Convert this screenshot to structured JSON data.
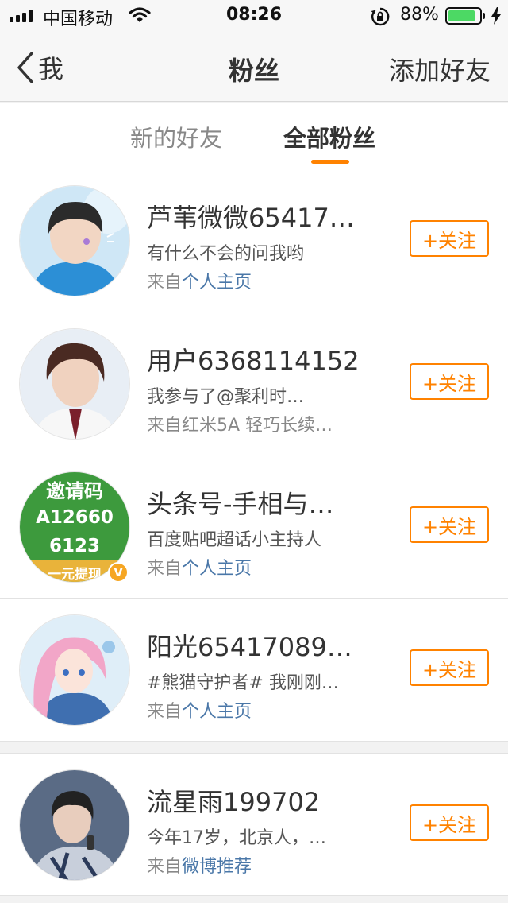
{
  "status_bar": {
    "carrier": "中国移动",
    "time": "08:26",
    "battery_percent": "88%",
    "battery_level": 0.88
  },
  "navbar": {
    "back_label": "我",
    "title": "粉丝",
    "right_action": "添加好友"
  },
  "tabs": [
    {
      "label": "新的好友",
      "active": false
    },
    {
      "label": "全部粉丝",
      "active": true
    }
  ],
  "colors": {
    "accent": "#ff8200",
    "link": "#4a77a8",
    "battery": "#4cd964",
    "verified_badge": "#f6a623"
  },
  "followers": [
    {
      "name": "芦苇微微65417…",
      "description": "有什么不会的问我哟",
      "source_prefix": "来自",
      "source_link": "个人主页",
      "follow_label": "+关注"
    },
    {
      "name": "用户6368114152",
      "description": "我参与了@聚利时…",
      "source_prefix": "来自红米5A 轻巧长续…",
      "source_link": "",
      "follow_label": "+关注"
    },
    {
      "name": "头条号-手相与…",
      "description": "百度贴吧超话小主持人",
      "source_prefix": "来自",
      "source_link": "个人主页",
      "follow_label": "+关注",
      "avatar_text": [
        "邀请码",
        "A12660",
        "6123",
        "一元提现"
      ],
      "verified": true
    },
    {
      "name": "阳光65417089…",
      "description": "#熊猫守护者# 我刚刚…",
      "source_prefix": "来自",
      "source_link": "个人主页",
      "follow_label": "+关注"
    },
    {
      "name": "流星雨199702",
      "description": "今年17岁，北京人，…",
      "source_prefix": "来自",
      "source_link": "微博推荐",
      "follow_label": "+关注"
    }
  ]
}
